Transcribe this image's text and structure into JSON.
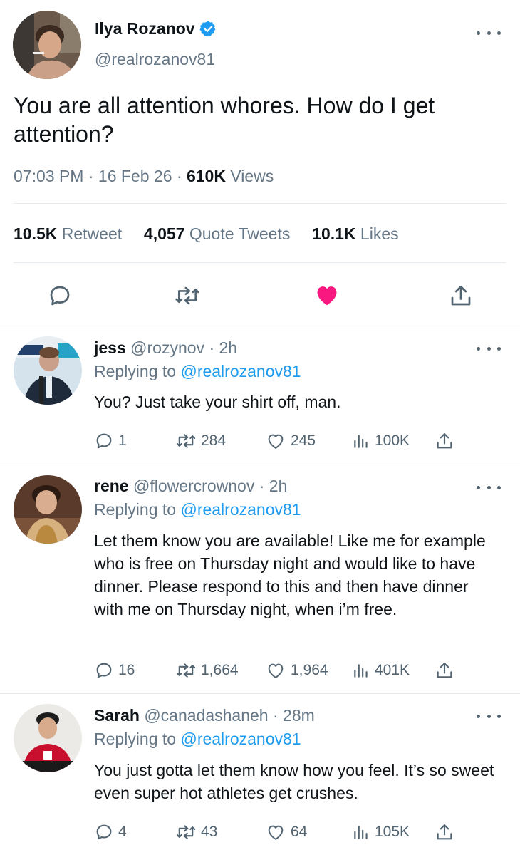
{
  "main_tweet": {
    "display_name": "Ilya Rozanov",
    "handle": "@realrozanov81",
    "text": "You are all attention whores. How do I get attention?",
    "time": "07:03 PM",
    "date": "16 Feb 26",
    "views_count": "610K",
    "views_label": "Views",
    "retweets_count": "10.5K",
    "retweets_label": "Retweet",
    "quotes_count": "4,057",
    "quotes_label": "Quote Tweets",
    "likes_count": "10.1K",
    "likes_label": "Likes",
    "sep": "·"
  },
  "replies": [
    {
      "name": "jess",
      "handle": "@rozynov",
      "age": "2h",
      "replying_label": "Replying to",
      "replying_to": "@realrozanov81",
      "text": "You? Just take your shirt off, man.",
      "reply_count": "1",
      "retweet_count": "284",
      "like_count": "245",
      "view_count": "100K"
    },
    {
      "name": "rene",
      "handle": "@flowercrownov",
      "age": "2h",
      "replying_label": "Replying to",
      "replying_to": "@realrozanov81",
      "text": "Let them know you are available! Like me for example who is free on Thursday night and would like to have dinner. Please respond to this and then have dinner with me on Thursday night, when i’m free.",
      "reply_count": "16",
      "retweet_count": "1,664",
      "like_count": "1,964",
      "view_count": "401K"
    },
    {
      "name": "Sarah",
      "handle": "@canadashaneh",
      "age": "28m",
      "replying_label": "Replying to",
      "replying_to": "@realrozanov81",
      "text": "You just gotta let them know how you feel. It’s so sweet even super hot athletes get crushes.",
      "reply_count": "4",
      "retweet_count": "43",
      "like_count": "64",
      "view_count": "105K"
    }
  ],
  "colors": {
    "accent": "#1d9bf0",
    "like_active": "#f91880",
    "muted_text": "#657786"
  },
  "icons": [
    "verified-badge-icon",
    "more-icon",
    "reply-icon",
    "retweet-icon",
    "like-icon",
    "share-icon",
    "views-icon"
  ]
}
